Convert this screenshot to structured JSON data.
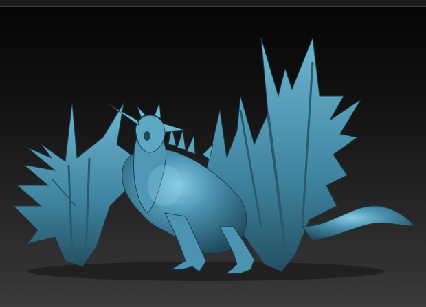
{
  "colors": {
    "background_top": "#050505",
    "background_bottom": "#3a3a3a",
    "matcap_base": "#3e7f9a",
    "matcap_highlight": "#7fc3dc",
    "matcap_shadow": "#1c3e4c"
  },
  "subject": {
    "icon": "dragon-sculpt"
  }
}
